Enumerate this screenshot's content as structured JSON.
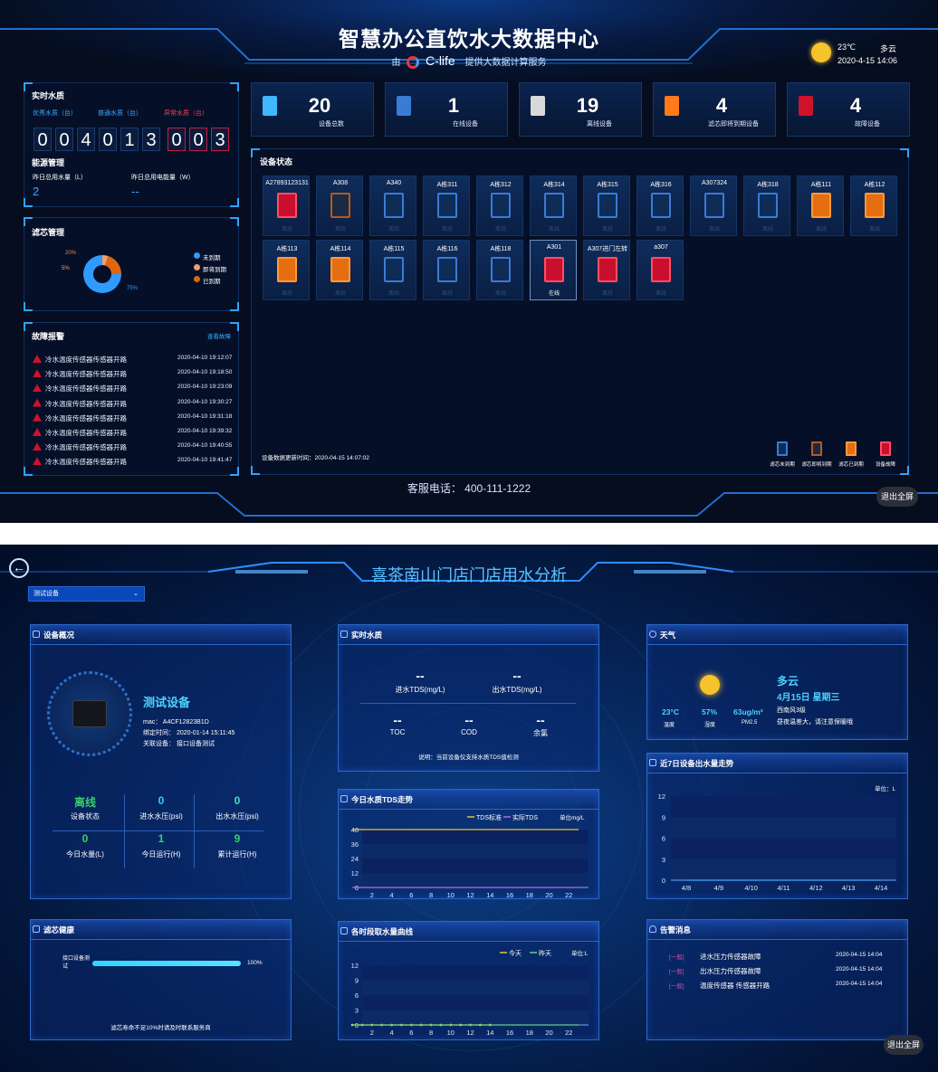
{
  "dash1": {
    "title": "智慧办公直饮水大数据中心",
    "subtitle_prefix": "由",
    "brand": "C-life",
    "subtitle_suffix": "提供大数据计算服务",
    "weather": {
      "temp": "23℃",
      "cond": "多云",
      "datetime": "2020-4-15 14:06"
    },
    "quality": {
      "title": "实时水质",
      "legend": [
        "优秀水质（台）",
        "普通水质（台）",
        "异常水质（台）"
      ],
      "digits": [
        "0",
        "0",
        "4",
        "0",
        "1",
        "3",
        "0",
        "0",
        "3"
      ],
      "red_from_index": 6
    },
    "energy": {
      "title": "能源管理",
      "water_label": "昨日总用水量（L）",
      "power_label": "昨日总用电能量（W）",
      "water_value": "2",
      "power_value": "--"
    },
    "filter": {
      "title": "滤芯管理",
      "pct_labels": [
        "20%",
        "5%",
        "75%"
      ],
      "legend": [
        "未到期",
        "即将到期",
        "已到期"
      ],
      "slices": [
        75,
        5,
        20
      ],
      "colors": [
        "#2f9bff",
        "#f0a06a",
        "#e0650f"
      ]
    },
    "faults": {
      "title": "故障报警",
      "link": "查看故障",
      "items": [
        {
          "text": "冷水温度传感器传感器开路",
          "time": "2020-04-10 19:12:07"
        },
        {
          "text": "冷水温度传感器传感器开路",
          "time": "2020-04-10 19:18:50"
        },
        {
          "text": "冷水温度传感器传感器开路",
          "time": "2020-04-10 19:23:09"
        },
        {
          "text": "冷水温度传感器传感器开路",
          "time": "2020-04-10 19:30:27"
        },
        {
          "text": "冷水温度传感器传感器开路",
          "time": "2020-04-10 19:31:18"
        },
        {
          "text": "冷水温度传感器传感器开路",
          "time": "2020-04-10 19:39:32"
        },
        {
          "text": "冷水温度传感器传感器开路",
          "time": "2020-04-10 19:40:55"
        },
        {
          "text": "冷水温度传感器传感器开路",
          "time": "2020-04-10 19:41:47"
        }
      ]
    },
    "stats": [
      {
        "value": "20",
        "label": "设备总数",
        "color": "#3fb7ff"
      },
      {
        "value": "1",
        "label": "在线设备",
        "color": "#3a7bd5"
      },
      {
        "value": "19",
        "label": "离线设备",
        "color": "#d9d9d9"
      },
      {
        "value": "4",
        "label": "滤芯即将到期设备",
        "color": "#ff7a1a"
      },
      {
        "value": "4",
        "label": "故障设备",
        "color": "#d0112b"
      }
    ],
    "device_status": {
      "title": "设备状态",
      "offline_text": "离线",
      "online_text": "在线",
      "row1": [
        {
          "name": "A27893123131",
          "kind": "red"
        },
        {
          "name": "A308",
          "kind": "brown"
        },
        {
          "name": "A340",
          "kind": "blue"
        },
        {
          "name": "A栋311",
          "kind": "blue"
        },
        {
          "name": "A栋312",
          "kind": "blue"
        },
        {
          "name": "A栋314",
          "kind": "blue"
        },
        {
          "name": "A栋315",
          "kind": "blue"
        },
        {
          "name": "A栋316",
          "kind": "blue"
        },
        {
          "name": "A307324",
          "kind": "blue"
        },
        {
          "name": "A栋318",
          "kind": "blue"
        },
        {
          "name": "A栋111",
          "kind": "orange"
        },
        {
          "name": "A栋112",
          "kind": "orange"
        }
      ],
      "row2": [
        {
          "name": "A栋113",
          "kind": "orange"
        },
        {
          "name": "A栋114",
          "kind": "orange"
        },
        {
          "name": "A栋115",
          "kind": "blue"
        },
        {
          "name": "A栋116",
          "kind": "blue"
        },
        {
          "name": "A栋118",
          "kind": "blue"
        },
        {
          "name": "A301",
          "kind": "red"
        },
        {
          "name": "A307进门左转",
          "kind": "red"
        },
        {
          "name": "a307",
          "kind": "red"
        }
      ],
      "updated": "设备数据更新时间：2020-04-15 14:07:02",
      "legend": [
        "滤芯未到期",
        "滤芯即将到期",
        "滤芯已到期",
        "设备故障"
      ]
    },
    "hotline": "客服电话：  400-111-1222",
    "exit": "退出全屏"
  },
  "dash2": {
    "title": "喜茶南山门店门店用水分析",
    "select": "测试设备",
    "overview": {
      "title": "设备概况",
      "device_name": "测试设备",
      "mac": "mac：  A4CF12823B1D",
      "bind": "绑定时间：  2020-01-14 15:11:45",
      "assoc": "关联设备：  接口设备测试",
      "cells": [
        {
          "value": "离线",
          "label": "设备状态"
        },
        {
          "value": "0",
          "label": "进水水压(psi)"
        },
        {
          "value": "0",
          "label": "出水水压(psi)"
        },
        {
          "value": "0",
          "label": "今日水量(L)"
        },
        {
          "value": "1",
          "label": "今日运行(H)"
        },
        {
          "value": "9",
          "label": "累计运行(H)"
        }
      ]
    },
    "realtime": {
      "title": "实时水质",
      "in_val": "--",
      "in_label": "进水TDS(mg/L)",
      "out_val": "--",
      "out_label": "出水TDS(mg/L)",
      "toc_val": "--",
      "toc_label": "TOC",
      "cod_val": "--",
      "cod_label": "COD",
      "cl_val": "--",
      "cl_label": "余氯",
      "note": "说明：当前设备仅支持水质TDS值检测"
    },
    "weather": {
      "title": "天气",
      "cond": "多云",
      "date": "4月15日 星期三",
      "wind": "西南风3级",
      "tip": "昼夜温差大，请注意保暖哦",
      "temp": "23°C",
      "temp_label": "温度",
      "hum": "57%",
      "hum_label": "湿度",
      "pm": "63ug/m³",
      "pm_label": "PM2.5"
    },
    "filter": {
      "title": "滤芯健康",
      "device_label": "接口设备测试",
      "pct_text": "100%",
      "pct": 100,
      "note": "滤芯寿命不足10%时请及时联系服务商"
    },
    "exit": "退出全屏"
  },
  "chart_data": [
    {
      "type": "line",
      "title": "今日水质TDS走势",
      "unit": "单位mg/L",
      "x": [
        0,
        1,
        2,
        3,
        4,
        5,
        6,
        7,
        8,
        9,
        10,
        11,
        12,
        13,
        14,
        15,
        16,
        17,
        18,
        19,
        20,
        21,
        22,
        23
      ],
      "xticks": [
        "2",
        "4",
        "6",
        "8",
        "10",
        "12",
        "14",
        "16",
        "18",
        "20",
        "22"
      ],
      "ylim": [
        0,
        48
      ],
      "yticks": [
        "48",
        "36",
        "24",
        "12",
        "0"
      ],
      "series": [
        {
          "name": "TDS标准",
          "color": "#e6c23a",
          "values": [
            50,
            50,
            50,
            50,
            50,
            50,
            50,
            50,
            50,
            50,
            50,
            50,
            50,
            50,
            50,
            50,
            50,
            50,
            50,
            50,
            50,
            50,
            50,
            50
          ]
        },
        {
          "name": "实际TDS",
          "color": "#b86be8",
          "values": [
            0,
            0,
            0,
            0,
            0,
            0,
            0,
            0,
            0,
            0,
            0,
            0,
            0,
            0,
            0,
            0,
            0,
            0,
            0,
            0,
            0,
            0,
            0,
            0
          ]
        }
      ]
    },
    {
      "type": "line",
      "title": "各时段取水量曲线",
      "unit": "单位:L",
      "x": [
        0,
        1,
        2,
        3,
        4,
        5,
        6,
        7,
        8,
        9,
        10,
        11,
        12,
        13,
        14,
        15,
        16,
        17,
        18,
        19,
        20,
        21,
        22,
        23
      ],
      "xticks": [
        "2",
        "4",
        "6",
        "8",
        "10",
        "12",
        "14",
        "16",
        "18",
        "20",
        "22"
      ],
      "ylim": [
        0,
        12
      ],
      "yticks": [
        "12",
        "9",
        "6",
        "3",
        "0"
      ],
      "series": [
        {
          "name": "今天",
          "color": "#e6c23a",
          "values": [
            0,
            0,
            0,
            0,
            0,
            0,
            0,
            0,
            0,
            0,
            0,
            0,
            0,
            0,
            0
          ]
        },
        {
          "name": "昨天",
          "color": "#5fd08a",
          "values": [
            0,
            0,
            0,
            0,
            0,
            0,
            0,
            0,
            0,
            0,
            0,
            0,
            0,
            0,
            0,
            0,
            0,
            0,
            0,
            0,
            0,
            0,
            0,
            0
          ]
        }
      ]
    },
    {
      "type": "line",
      "title": "近7日设备出水量走势",
      "unit": "单位：L",
      "categories": [
        "4/8",
        "4/9",
        "4/10",
        "4/11",
        "4/12",
        "4/13",
        "4/14"
      ],
      "ylim": [
        0,
        12
      ],
      "yticks": [
        "12",
        "9",
        "6",
        "3",
        "0"
      ],
      "series": [
        {
          "color": "#4aa3ff",
          "values": [
            0,
            0,
            0,
            0,
            0,
            0,
            0
          ]
        }
      ]
    }
  ],
  "alerts": {
    "title": "告警消息",
    "items": [
      {
        "level": "[一般]",
        "text": "进水压力传感器故障",
        "time": "2020-04-15 14:04"
      },
      {
        "level": "[一般]",
        "text": "出水压力传感器故障",
        "time": "2020-04-15 14:04"
      },
      {
        "level": "[一般]",
        "text": "温度传感器 传感器开路",
        "time": "2020-04-15 14:04"
      }
    ]
  }
}
